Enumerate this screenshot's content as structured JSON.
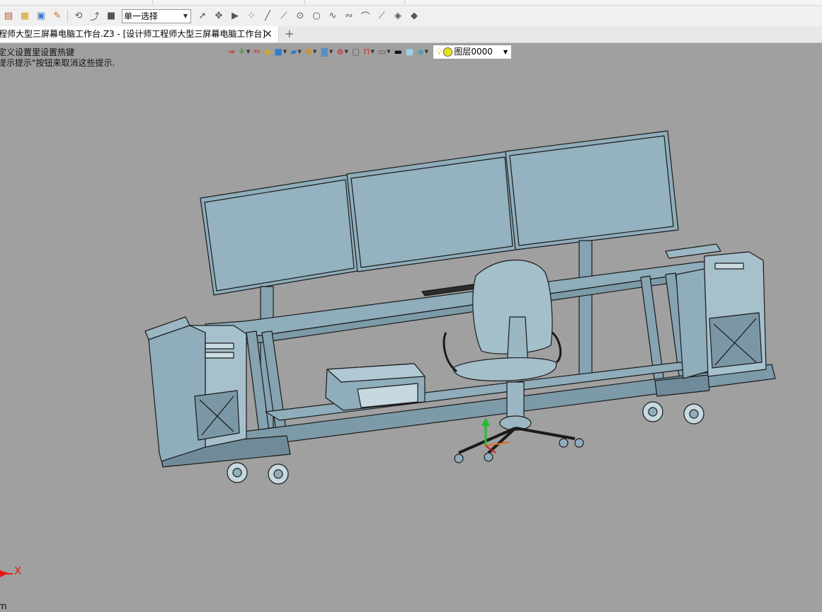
{
  "toolbar": {
    "selection_mode": "单一选择"
  },
  "document_tab": {
    "title": "程师大型三屏幕电脑工作台.Z3 - [设计师工程师大型三屏幕电脑工作台]",
    "close_glyph": "✕",
    "add_glyph": "+"
  },
  "hints": {
    "line1": "定义设置里设置热键",
    "line2": "提示提示\"按钮来取消这些提示."
  },
  "view_toolbar": {
    "layer_name": "图层0000"
  },
  "viewport": {
    "axis_label": "X",
    "units_partial": "m"
  },
  "colors": {
    "viewport_bg": "#a0a0a0",
    "model_fill": "#8fadbb",
    "model_edge": "#1a1a1a",
    "axis_red": "#e21818",
    "gizmo_green": "#1fbf2a"
  }
}
